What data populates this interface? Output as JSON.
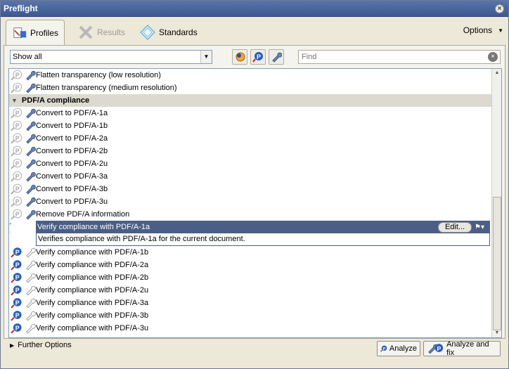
{
  "window": {
    "title": "Preflight"
  },
  "tabs": [
    {
      "label": "Profiles",
      "icon": "profiles-icon",
      "active": true
    },
    {
      "label": "Results",
      "icon": "results-icon",
      "active": false
    },
    {
      "label": "Standards",
      "icon": "standards-icon",
      "active": false
    }
  ],
  "options_label": "Options",
  "toolbar": {
    "filter_value": "Show all",
    "find_placeholder": "Find"
  },
  "list": {
    "rows_before": [
      {
        "label": "Flatten transparency (low resolution)"
      },
      {
        "label": "Flatten transparency (medium resolution)"
      }
    ],
    "section": {
      "label": "PDF/A compliance"
    },
    "fixup_rows": [
      {
        "label": "Convert to PDF/A-1a"
      },
      {
        "label": "Convert to PDF/A-1b"
      },
      {
        "label": "Convert to PDF/A-2a"
      },
      {
        "label": "Convert to PDF/A-2b"
      },
      {
        "label": "Convert to PDF/A-2u"
      },
      {
        "label": "Convert to PDF/A-3a"
      },
      {
        "label": "Convert to PDF/A-3b"
      },
      {
        "label": "Convert to PDF/A-3u"
      },
      {
        "label": "Remove PDF/A information"
      }
    ],
    "selected": {
      "label": "Verify compliance with PDF/A-1a",
      "edit_label": "Edit...",
      "description": "Verifies compliance with PDF/A-1a for the current document."
    },
    "check_rows": [
      {
        "label": "Verify compliance with PDF/A-1b"
      },
      {
        "label": "Verify compliance with PDF/A-2a"
      },
      {
        "label": "Verify compliance with PDF/A-2b"
      },
      {
        "label": "Verify compliance with PDF/A-2u"
      },
      {
        "label": "Verify compliance with PDF/A-3a"
      },
      {
        "label": "Verify compliance with PDF/A-3b"
      },
      {
        "label": "Verify compliance with PDF/A-3u"
      }
    ]
  },
  "bottom": {
    "further_options": "Further Options",
    "analyze": "Analyze",
    "analyze_fix": "Analyze and fix"
  },
  "colors": {
    "selection": "#4b5e85",
    "titlebar": "#3d5993"
  }
}
